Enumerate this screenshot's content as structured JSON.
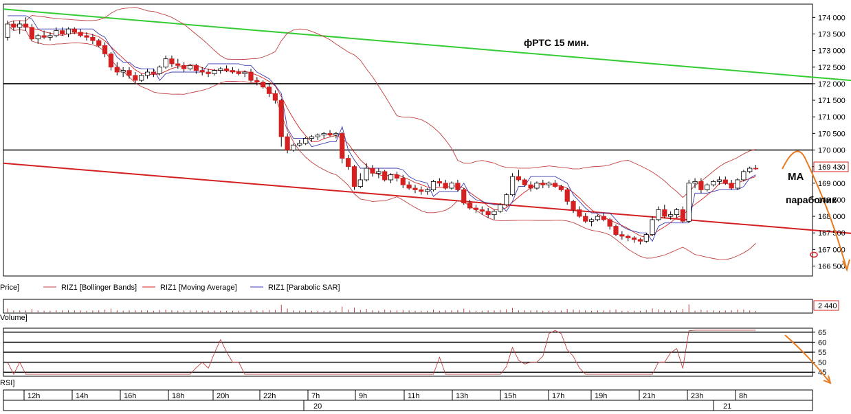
{
  "chart_data": [
    {
      "type": "candlestick",
      "panel": "price",
      "title": "фРТС   15 мин.",
      "y_ticks": [
        "174 000",
        "173 500",
        "173 000",
        "172 500",
        "172 000",
        "171 500",
        "171 000",
        "170 500",
        "170 000",
        "169 500",
        "169 000",
        "168 500",
        "168 000",
        "167 500",
        "167 000",
        "166 500"
      ],
      "ylim": [
        166200,
        174400
      ],
      "last_price_label": "169 430",
      "legend": [
        "Price]",
        "RIZ1 [Bollinger Bands]",
        "RIZ1 [Moving Average]",
        "RIZ1 [Parabolic SAR]"
      ],
      "horizontal_levels": [
        172000,
        170000
      ],
      "trendlines": [
        {
          "color": "#33cc33",
          "points": [
            [
              0,
              174250
            ],
            [
              184,
              171400
            ]
          ]
        },
        {
          "color": "#d42020",
          "points": [
            [
              0,
              169600
            ],
            [
              184,
              166800
            ]
          ]
        }
      ],
      "candles": [
        [
          0,
          173400,
          173900,
          173300,
          173800
        ],
        [
          1,
          173800,
          173900,
          173600,
          173700
        ],
        [
          2,
          173700,
          173900,
          173500,
          173800
        ],
        [
          3,
          173800,
          174000,
          173600,
          173700
        ],
        [
          4,
          173700,
          173800,
          173300,
          173350
        ],
        [
          5,
          173350,
          173500,
          173200,
          173450
        ],
        [
          6,
          173450,
          173600,
          173350,
          173400
        ],
        [
          7,
          173400,
          173550,
          173300,
          173450
        ],
        [
          8,
          173450,
          173700,
          173400,
          173600
        ],
        [
          9,
          173600,
          173700,
          173450,
          173500
        ],
        [
          10,
          173500,
          173700,
          173400,
          173650
        ],
        [
          11,
          173650,
          173700,
          173500,
          173550
        ],
        [
          12,
          173550,
          173650,
          173400,
          173450
        ],
        [
          13,
          173450,
          173550,
          173300,
          173400
        ],
        [
          14,
          173400,
          173500,
          173200,
          173300
        ],
        [
          15,
          173300,
          173350,
          173100,
          173150
        ],
        [
          16,
          173150,
          173250,
          172800,
          172900
        ],
        [
          17,
          172900,
          172950,
          172400,
          172500
        ],
        [
          18,
          172500,
          172650,
          172250,
          172350
        ],
        [
          19,
          172350,
          172500,
          172200,
          172400
        ],
        [
          20,
          172400,
          172500,
          172150,
          172250
        ],
        [
          21,
          172250,
          172350,
          172000,
          172100
        ],
        [
          22,
          172100,
          172300,
          172050,
          172250
        ],
        [
          23,
          172250,
          172450,
          172150,
          172350
        ],
        [
          24,
          172350,
          172450,
          172200,
          172300
        ],
        [
          25,
          172300,
          172550,
          172250,
          172500
        ],
        [
          26,
          172500,
          172850,
          172450,
          172750
        ],
        [
          27,
          172750,
          172850,
          172500,
          172600
        ],
        [
          28,
          172600,
          172750,
          172450,
          172550
        ],
        [
          29,
          172550,
          172650,
          172350,
          172450
        ],
        [
          30,
          172450,
          172600,
          172400,
          172550
        ],
        [
          31,
          172550,
          172600,
          172300,
          172400
        ],
        [
          32,
          172400,
          172500,
          172250,
          172350
        ],
        [
          33,
          172350,
          172450,
          172200,
          172300
        ],
        [
          34,
          172300,
          172450,
          172250,
          172400
        ],
        [
          35,
          172400,
          172500,
          172300,
          172450
        ],
        [
          36,
          172450,
          172550,
          172350,
          172400
        ],
        [
          37,
          172400,
          172500,
          172300,
          172350
        ],
        [
          38,
          172350,
          172450,
          172250,
          172300
        ],
        [
          39,
          172300,
          172400,
          172200,
          172350
        ],
        [
          40,
          172350,
          172450,
          172050,
          172100
        ],
        [
          41,
          172100,
          172200,
          171950,
          172050
        ],
        [
          42,
          172050,
          172100,
          171850,
          171900
        ],
        [
          43,
          171900,
          172000,
          171600,
          171700
        ],
        [
          44,
          171700,
          171800,
          171400,
          171500
        ],
        [
          45,
          171500,
          171550,
          170100,
          170400
        ],
        [
          46,
          170400,
          170500,
          169900,
          170000
        ],
        [
          47,
          170000,
          170200,
          169950,
          170150
        ],
        [
          48,
          170150,
          170300,
          170100,
          170200
        ],
        [
          49,
          170200,
          170400,
          170150,
          170350
        ],
        [
          50,
          170350,
          170450,
          170250,
          170400
        ],
        [
          51,
          170400,
          170500,
          170300,
          170450
        ],
        [
          52,
          170450,
          170550,
          170350,
          170500
        ],
        [
          53,
          170500,
          170600,
          170400,
          170450
        ],
        [
          54,
          170450,
          170550,
          170350,
          170500
        ],
        [
          55,
          170500,
          170550,
          169600,
          169750
        ],
        [
          56,
          169750,
          169850,
          169400,
          169500
        ],
        [
          57,
          169500,
          169550,
          168800,
          168900
        ],
        [
          58,
          168900,
          169300,
          168850,
          169100
        ],
        [
          59,
          169100,
          169600,
          169050,
          169450
        ],
        [
          60,
          169450,
          169550,
          169200,
          169300
        ],
        [
          61,
          169300,
          169450,
          169150,
          169350
        ],
        [
          62,
          169350,
          169400,
          169050,
          169100
        ],
        [
          63,
          169100,
          169300,
          169000,
          169250
        ],
        [
          64,
          169250,
          169350,
          169050,
          169150
        ],
        [
          65,
          169150,
          169250,
          168850,
          168950
        ],
        [
          66,
          168950,
          169050,
          168800,
          168850
        ],
        [
          67,
          168850,
          168950,
          168700,
          168800
        ],
        [
          68,
          168800,
          168900,
          168650,
          168750
        ],
        [
          69,
          168750,
          168850,
          168650,
          168800
        ],
        [
          70,
          168800,
          169100,
          168750,
          169050
        ],
        [
          71,
          169050,
          169150,
          168900,
          169000
        ],
        [
          72,
          169000,
          169100,
          168800,
          168850
        ],
        [
          73,
          168850,
          169050,
          168800,
          169000
        ],
        [
          74,
          169000,
          169100,
          168750,
          168800
        ],
        [
          75,
          168800,
          168850,
          168350,
          168400
        ],
        [
          76,
          168400,
          168500,
          168200,
          168250
        ],
        [
          77,
          168250,
          168350,
          168100,
          168200
        ],
        [
          78,
          168200,
          168300,
          168050,
          168150
        ],
        [
          79,
          168150,
          168250,
          167950,
          168050
        ],
        [
          80,
          168050,
          168200,
          167900,
          168150
        ],
        [
          81,
          168150,
          168400,
          168100,
          168350
        ],
        [
          82,
          168350,
          168700,
          168300,
          168650
        ],
        [
          83,
          168650,
          169300,
          168600,
          169200
        ],
        [
          84,
          169200,
          169400,
          169050,
          169100
        ],
        [
          85,
          169100,
          169150,
          168900,
          168950
        ],
        [
          86,
          168950,
          169050,
          168750,
          168850
        ],
        [
          87,
          168850,
          169050,
          168800,
          169000
        ],
        [
          88,
          169000,
          169100,
          168850,
          168950
        ],
        [
          89,
          168950,
          169050,
          168850,
          169000
        ],
        [
          90,
          169000,
          169100,
          168850,
          168900
        ],
        [
          91,
          168900,
          168950,
          168750,
          168800
        ],
        [
          92,
          168800,
          168850,
          168350,
          168450
        ],
        [
          93,
          168450,
          168500,
          168100,
          168200
        ],
        [
          94,
          168200,
          168300,
          167950,
          168000
        ],
        [
          95,
          168000,
          168100,
          167800,
          167850
        ],
        [
          96,
          167850,
          167950,
          167700,
          167900
        ],
        [
          97,
          167900,
          168050,
          167850,
          168000
        ],
        [
          98,
          168000,
          168100,
          167850,
          167900
        ],
        [
          99,
          167900,
          167950,
          167600,
          167700
        ],
        [
          100,
          167700,
          167750,
          167400,
          167450
        ],
        [
          101,
          167450,
          167550,
          167300,
          167400
        ],
        [
          102,
          167400,
          167450,
          167250,
          167350
        ],
        [
          103,
          167350,
          167400,
          167200,
          167300
        ],
        [
          104,
          167300,
          167350,
          167150,
          167250
        ],
        [
          105,
          167250,
          167500,
          167200,
          167450
        ],
        [
          106,
          167450,
          168000,
          167400,
          167900
        ],
        [
          107,
          167900,
          168300,
          167850,
          168200
        ],
        [
          108,
          168200,
          168350,
          167950,
          168000
        ],
        [
          109,
          168000,
          168150,
          167900,
          168050
        ],
        [
          110,
          168050,
          168250,
          167950,
          168200
        ],
        [
          111,
          168200,
          168300,
          167800,
          167850
        ],
        [
          112,
          167850,
          169100,
          167800,
          169000
        ],
        [
          113,
          169000,
          169150,
          168850,
          169050
        ],
        [
          114,
          169050,
          169150,
          168700,
          168800
        ],
        [
          115,
          168800,
          169000,
          168750,
          168950
        ],
        [
          116,
          168950,
          169100,
          168900,
          169050
        ],
        [
          117,
          169050,
          169200,
          168950,
          169100
        ],
        [
          118,
          169100,
          169200,
          168950,
          169000
        ],
        [
          119,
          169000,
          169100,
          168800,
          168850
        ],
        [
          120,
          168850,
          169150,
          168800,
          169100
        ],
        [
          121,
          169100,
          169400,
          169050,
          169350
        ],
        [
          122,
          169350,
          169500,
          169300,
          169450
        ],
        [
          123,
          169450,
          169550,
          169400,
          169430
        ]
      ]
    },
    {
      "type": "bar",
      "panel": "volume",
      "legend": "Volume]",
      "last_value_label": "2 440"
    },
    {
      "type": "line",
      "panel": "rsi",
      "legend": "RSI]",
      "y_ticks": [
        "65",
        "60",
        "55",
        "50",
        "45"
      ],
      "ylim": [
        43,
        67
      ]
    }
  ],
  "x_axis": {
    "time_labels": [
      "12h",
      "14h",
      "16h",
      "18h",
      "20h",
      "22h",
      "7h",
      "9h",
      "11h",
      "13h",
      "15h",
      "17h",
      "19h",
      "21h",
      "23h",
      "8h"
    ],
    "date_labels": [
      "20",
      "21"
    ]
  },
  "annotations": {
    "ma_label": "MA",
    "sar_label": "параболик"
  },
  "colors": {
    "bull_candle": "#ffffff",
    "bear_candle": "#d42020",
    "bollinger": "#c04040",
    "moving_average": "#d42020",
    "parabolic_sar": "#3b3bb5",
    "upper_trend": "#33cc33",
    "lower_trend": "#d42020",
    "forecast": "#e87a20"
  }
}
